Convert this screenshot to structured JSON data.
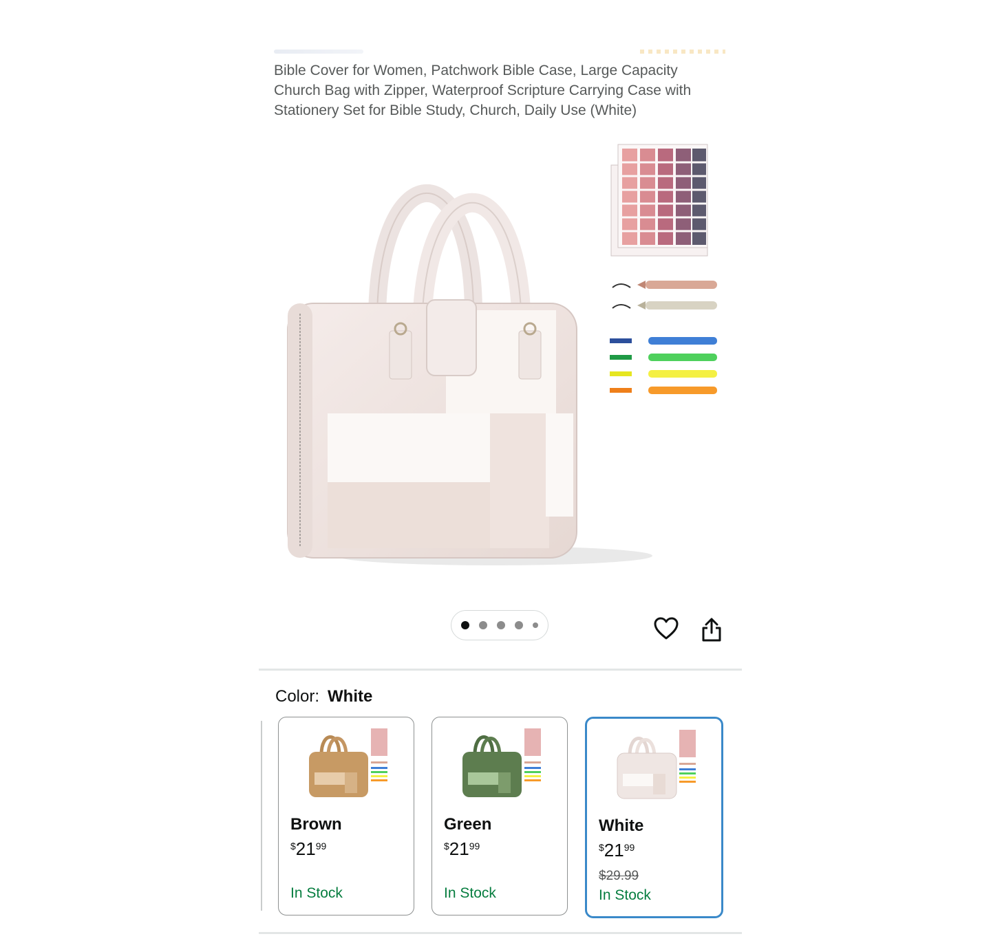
{
  "product": {
    "title": "Bible Cover for Women, Patchwork Bible Case, Large Capacity Church Bag with Zipper, Waterproof Scripture Carrying Case with Stationery Set for Bible Study, Church, Daily Use (White)"
  },
  "gallery": {
    "image_count": 5,
    "active_index": 1
  },
  "color_selector": {
    "label": "Color:",
    "selected": "White",
    "options": [
      {
        "name": "Brown",
        "price_symbol": "$",
        "price_whole": "21",
        "price_cents": "99",
        "list_price": "",
        "stock": "In Stock",
        "swatch": "#c79a64"
      },
      {
        "name": "Green",
        "price_symbol": "$",
        "price_whole": "21",
        "price_cents": "99",
        "list_price": "",
        "stock": "In Stock",
        "swatch": "#5d7d4f"
      },
      {
        "name": "White",
        "price_symbol": "$",
        "price_whole": "21",
        "price_cents": "99",
        "list_price": "$29.99",
        "stock": "In Stock",
        "swatch": "#efe6e3"
      }
    ]
  },
  "icons": {
    "favorite": "heart-icon",
    "share": "share-icon"
  },
  "colors": {
    "selected_border": "#3a89c9",
    "in_stock": "#067d3f"
  }
}
